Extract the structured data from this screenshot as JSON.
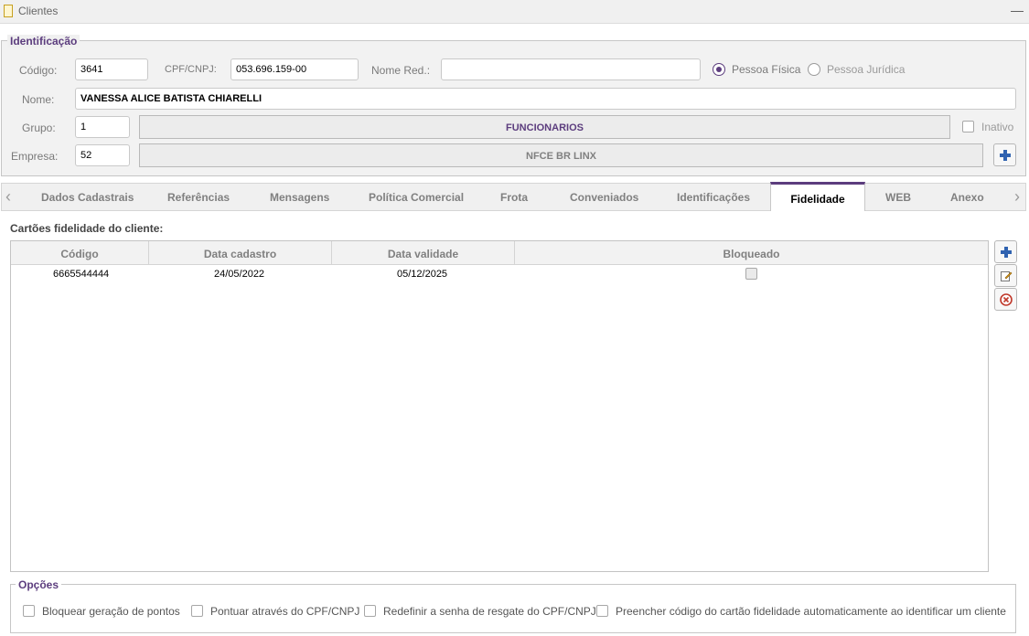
{
  "window": {
    "title": "Clientes",
    "minimize": "—"
  },
  "ident": {
    "legend": "Identificação",
    "codigo_label": "Código:",
    "codigo_value": "3641",
    "cpf_label": "CPF/CNPJ:",
    "cpf_value": "053.696.159-00",
    "nome_red_label": "Nome Red.:",
    "nome_red_value": "",
    "pessoa_fisica": "Pessoa Física",
    "pessoa_juridica": "Pessoa Jurídica",
    "nome_label": "Nome:",
    "nome_value": "VANESSA ALICE BATISTA CHIARELLI",
    "grupo_label": "Grupo:",
    "grupo_value": "1",
    "grupo_name": "FUNCIONARIOS",
    "inativo_label": "Inativo",
    "empresa_label": "Empresa:",
    "empresa_value": "52",
    "empresa_name": "NFCE BR LINX"
  },
  "tabs": [
    "Dados Cadastrais",
    "Referências",
    "Mensagens",
    "Política Comercial",
    "Frota",
    "Conveniados",
    "Identificações",
    "Fidelidade",
    "WEB",
    "Anexo"
  ],
  "fidelidade": {
    "section_title": "Cartões fidelidade do cliente:",
    "columns": [
      "Código",
      "Data cadastro",
      "Data validade",
      "Bloqueado"
    ],
    "rows": [
      {
        "codigo": "6665544444",
        "data_cadastro": "24/05/2022",
        "data_validade": "05/12/2025",
        "bloqueado": false
      }
    ]
  },
  "opcoes": {
    "legend": "Opções",
    "items": [
      "Bloquear geração de pontos",
      "Pontuar através do CPF/CNPJ",
      "Redefinir a senha de resgate do CPF/CNPJ",
      "Preencher código do cartão fidelidade automaticamente ao identificar um cliente"
    ]
  },
  "colors": {
    "accent": "#5c3d7e",
    "action_blue": "#2f62b0",
    "delete_red": "#c0392b"
  },
  "icons": {
    "add": "plus-icon",
    "edit": "edit-icon",
    "delete": "delete-icon"
  }
}
